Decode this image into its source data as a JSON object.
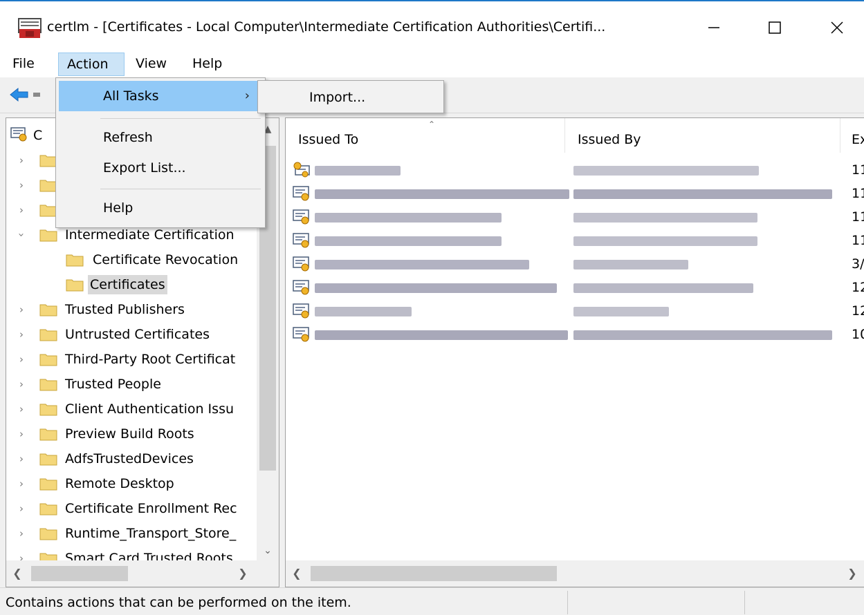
{
  "window": {
    "title": "certlm - [Certificates - Local Computer\\Intermediate Certification Authorities\\Certifi...",
    "minimize_icon": "minimize-icon",
    "maximize_icon": "maximize-icon",
    "close_icon": "close-icon"
  },
  "menubar": {
    "items": [
      "File",
      "Action",
      "View",
      "Help"
    ],
    "open_item": "Action"
  },
  "action_menu": {
    "all_tasks": "All Tasks",
    "refresh": "Refresh",
    "export_list": "Export List...",
    "help": "Help"
  },
  "all_tasks_submenu": {
    "import": "Import..."
  },
  "tree": {
    "root_label_partial": "C",
    "items": [
      {
        "label": "Intermediate Certification",
        "expanded": true
      },
      {
        "label": "Certificate Revocation"
      },
      {
        "label": "Certificates",
        "selected": true
      },
      {
        "label": "Trusted Publishers"
      },
      {
        "label": "Untrusted Certificates"
      },
      {
        "label": "Third-Party Root Certificat"
      },
      {
        "label": "Trusted People"
      },
      {
        "label": "Client Authentication Issu"
      },
      {
        "label": "Preview Build Roots"
      },
      {
        "label": "AdfsTrustedDevices"
      },
      {
        "label": "Remote Desktop"
      },
      {
        "label": "Certificate Enrollment Rec"
      },
      {
        "label": "Runtime_Transport_Store_"
      },
      {
        "label": "Smart Card Trusted Roots"
      }
    ]
  },
  "list": {
    "columns": [
      "Issued To",
      "Issued By",
      "Ex"
    ],
    "rows": [
      {
        "expiration_partial": "11"
      },
      {
        "expiration_partial": "11"
      },
      {
        "expiration_partial": "11"
      },
      {
        "expiration_partial": "11"
      },
      {
        "expiration_partial": "3/"
      },
      {
        "expiration_partial": "12"
      },
      {
        "expiration_partial": "12"
      },
      {
        "expiration_partial": "10"
      }
    ]
  },
  "statusbar": {
    "text": "Contains actions that can be performed on the item."
  },
  "colors": {
    "menu_highlight": "#91c9f7",
    "menu_open": "#cce4f7",
    "selection": "#d9d9d9",
    "folder": "#f4d77a",
    "cert_seal": "#f0b428",
    "blurred_text": "#b9b9c4"
  }
}
